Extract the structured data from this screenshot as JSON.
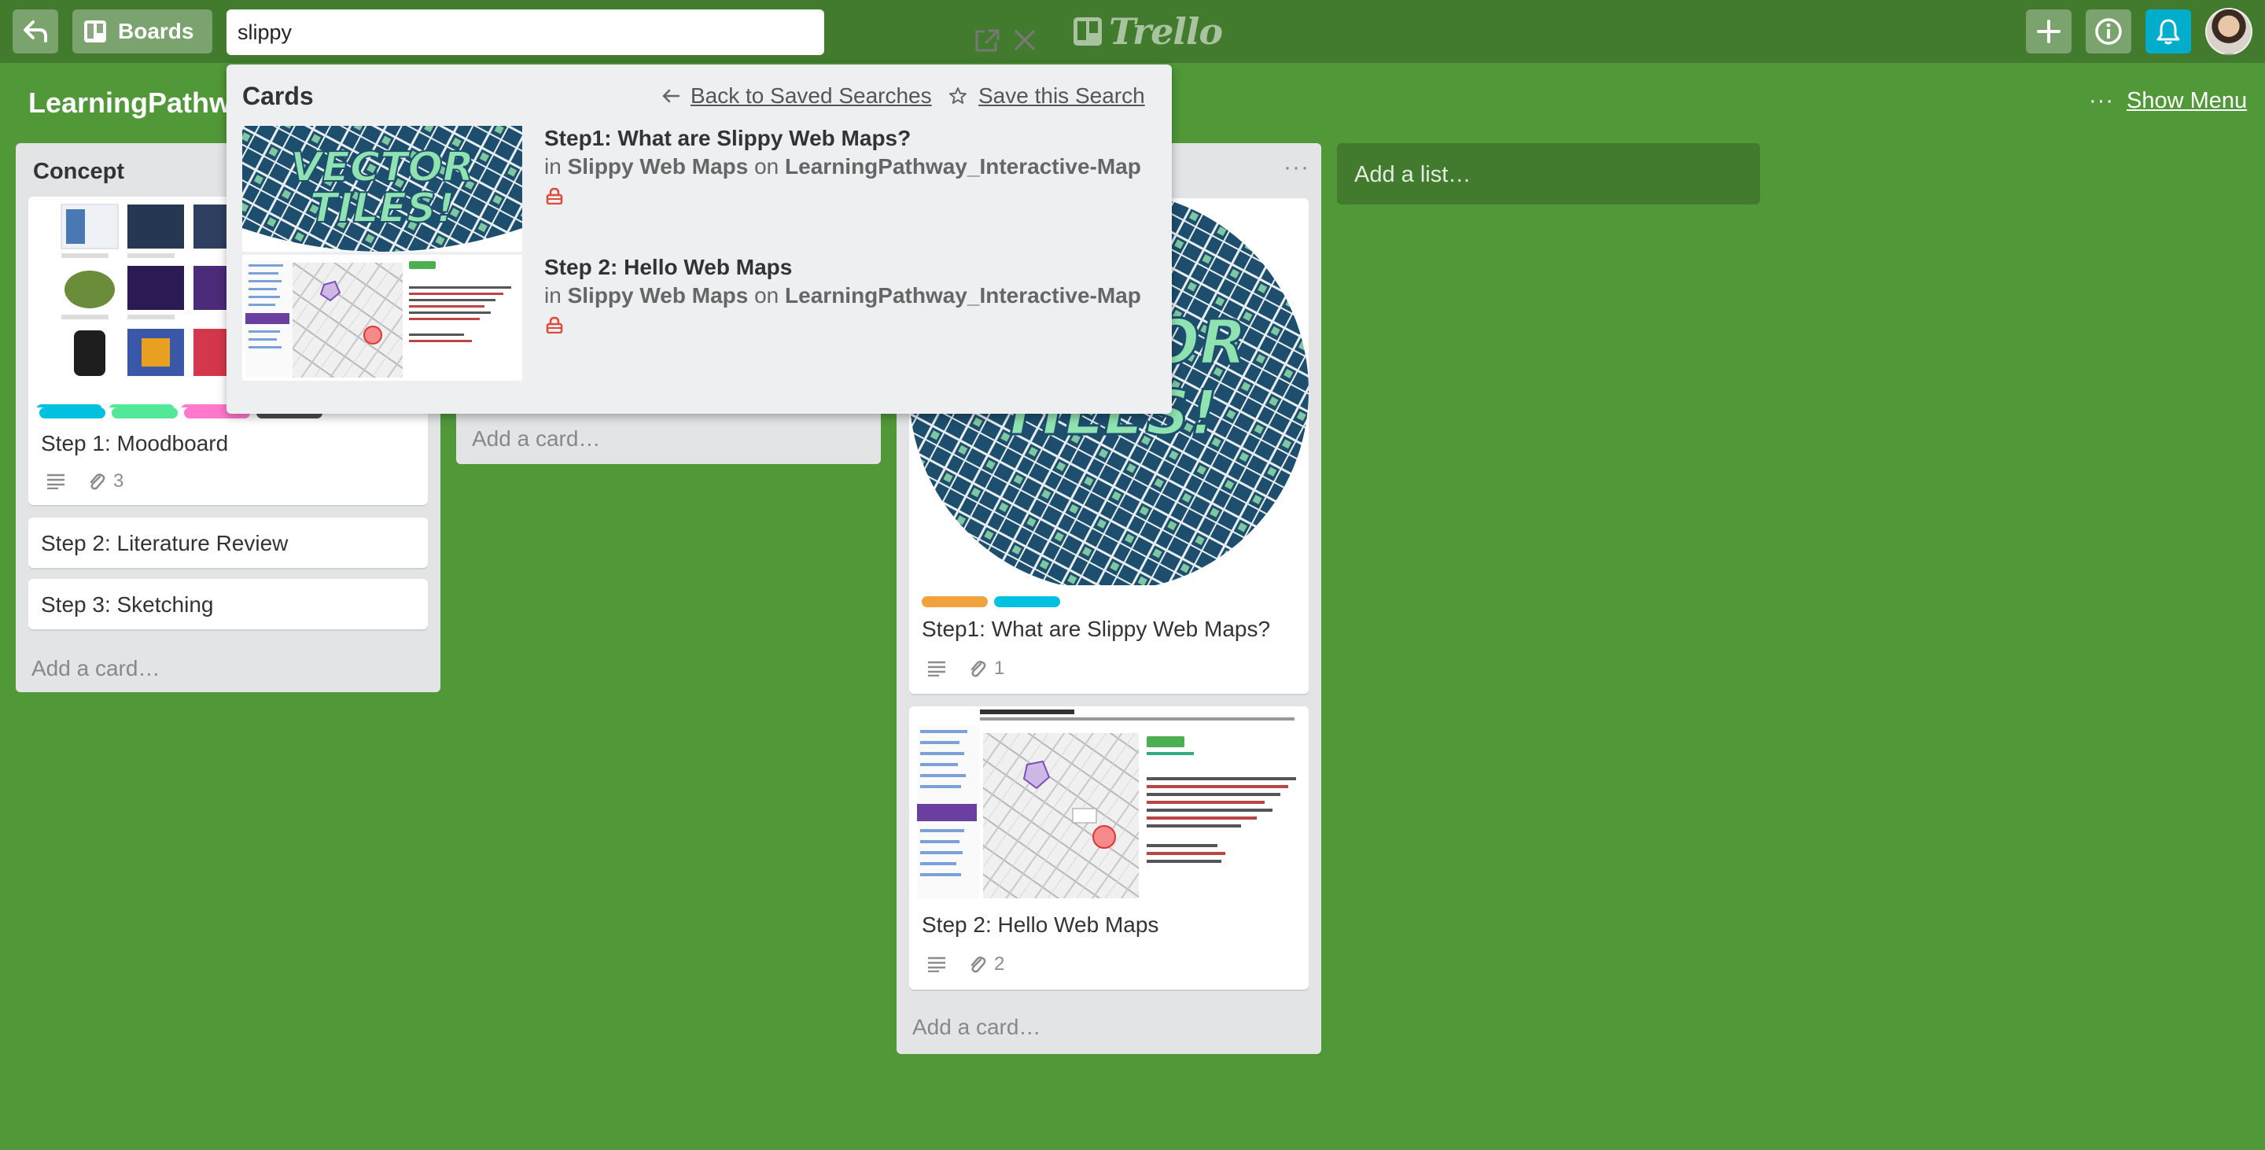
{
  "header": {
    "boards_label": "Boards",
    "search_value": "slippy",
    "logo_text": "Trello"
  },
  "board": {
    "title": "LearningPathw",
    "show_menu_dots": "···",
    "show_menu_label": "Show Menu",
    "add_list": "Add a list…"
  },
  "lists": [
    {
      "title": "Concept",
      "cards": [
        {
          "title": "Step 1: Moodboard",
          "attachments": "3"
        },
        {
          "title": "Step 2: Literature Review"
        },
        {
          "title": "Step 3: Sketching"
        }
      ],
      "add_card": "Add a card…"
    },
    {
      "add_card": "Add a card…"
    },
    {
      "menu": "···",
      "cards": [
        {
          "title": "Step1: What are Slippy Web Maps?",
          "attachments": "1",
          "labels": [
            "#f2a23c",
            "#00c2e0"
          ]
        },
        {
          "title": "Step 2: Hello Web Maps",
          "attachments": "2"
        }
      ],
      "add_card": "Add a card…"
    }
  ],
  "label_colors": {
    "moodboard": [
      "#00c2e0",
      "#51e898",
      "#ff78cb",
      "#4d4d4d"
    ]
  },
  "search_results": {
    "heading": "Cards",
    "back_label": "Back to Saved Searches",
    "save_label": "Save this Search",
    "items": [
      {
        "title": "Step1: What are Slippy Web Maps?",
        "in_word": "in",
        "list_name": "Slippy Web Maps",
        "on_word": "on",
        "board_name": "LearningPathway_Interactive-Map"
      },
      {
        "title": "Step 2: Hello Web Maps",
        "in_word": "in",
        "list_name": "Slippy Web Maps",
        "on_word": "on",
        "board_name": "LearningPathway_Interactive-Map"
      }
    ]
  }
}
